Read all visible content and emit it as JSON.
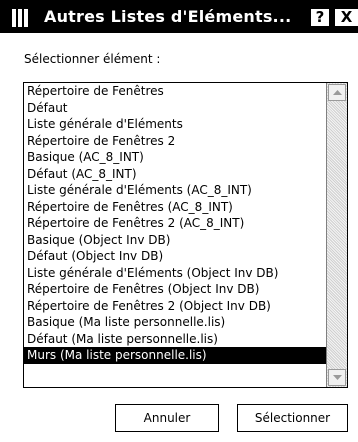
{
  "window": {
    "title": "Autres Listes d'Eléments...",
    "help_label": "?",
    "close_label": "X"
  },
  "prompt": "Sélectionner élément :",
  "list": {
    "items": [
      "Répertoire de Fenêtres",
      "Défaut",
      "Liste générale d'Eléments",
      "Répertoire de Fenêtres 2",
      "Basique (AC_8_INT)",
      "Défaut (AC_8_INT)",
      "Liste générale d'Eléments (AC_8_INT)",
      "Répertoire de Fenêtres (AC_8_INT)",
      "Répertoire de Fenêtres 2 (AC_8_INT)",
      "Basique (Object Inv DB)",
      "Défaut (Object Inv DB)",
      "Liste générale d'Eléments (Object Inv DB)",
      "Répertoire de Fenêtres (Object Inv DB)",
      "Répertoire de Fenêtres 2 (Object Inv DB)",
      "Basique (Ma liste personnelle.lis)",
      "Défaut (Ma liste personnelle.lis)",
      "Murs (Ma liste personnelle.lis)"
    ],
    "selected_index": 16
  },
  "buttons": {
    "cancel_label": "Annuler",
    "select_label": "Sélectionner"
  }
}
